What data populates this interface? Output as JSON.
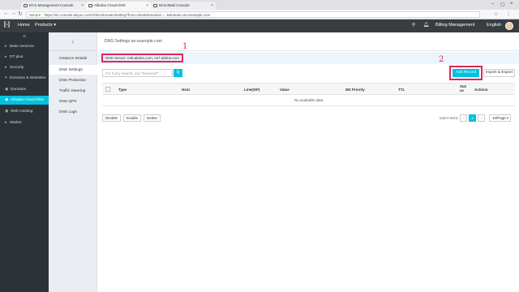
{
  "browser": {
    "tabs": [
      {
        "label": "ECS Management Console"
      },
      {
        "label": "Alibaba Cloud DNS"
      },
      {
        "label": "DirectMail Console"
      }
    ],
    "secure_label": "Secure",
    "url": "https://dc.console.aliyun.com/#/dns/domain/setting?from=dns&domainId=... &domain=an-example.com"
  },
  "topnav": {
    "logo": "[-]",
    "home": "Home",
    "products": "Products ▾",
    "billing": "Billing Management",
    "language": "English"
  },
  "sidebar": {
    "top_label": "⊞",
    "items": [
      {
        "label": "Base services",
        "caret": "▸"
      },
      {
        "label": "DT plus",
        "caret": "▸"
      },
      {
        "label": "Security",
        "caret": "▸"
      },
      {
        "label": "Domains & Websites",
        "caret": "▾"
      },
      {
        "label": "Domains",
        "icon": "◉"
      },
      {
        "label": "Alibaba Cloud DNS",
        "icon": "◉"
      },
      {
        "label": "Web Hosting",
        "icon": "◉"
      },
      {
        "label": "Market",
        "caret": "▸"
      }
    ]
  },
  "subsidebar": {
    "back": "‹",
    "items": [
      {
        "label": "Instance Details"
      },
      {
        "label": "DNS Settings"
      },
      {
        "label": "DNS Protection"
      },
      {
        "label": "Traffic Steering"
      },
      {
        "label": "DNS QPS"
      },
      {
        "label": "DNS Logs"
      }
    ]
  },
  "main": {
    "breadcrumb": "DNS Settings an-example.com",
    "dns_server": "DNS Server: ns9.alidns.com, ns7.alidns.com",
    "annotation_1": "1",
    "annotation_2": "2",
    "search_placeholder": "For fuzzy search, use \"keyword*\"",
    "search_icon": "⚲",
    "add_record": "Add Record",
    "import_export": "Import & Export",
    "columns": [
      "Type",
      "Host",
      "Line(ISP)",
      "Value",
      "MX Priority",
      "TTL",
      "Stat us",
      "Actions"
    ],
    "empty_text": "No available data",
    "footer_buttons": [
      "Disable",
      "Enable",
      "Delete"
    ],
    "total": "total 0 items",
    "page_prev": "‹",
    "page_current": "1",
    "page_next": "›",
    "per_page": "10/Page",
    "per_page_dd": "▾"
  },
  "colors": {
    "accent": "#00c1de",
    "annotation": "#e0245e",
    "topnav": "#373d41",
    "sidebar": "#2b3339"
  }
}
